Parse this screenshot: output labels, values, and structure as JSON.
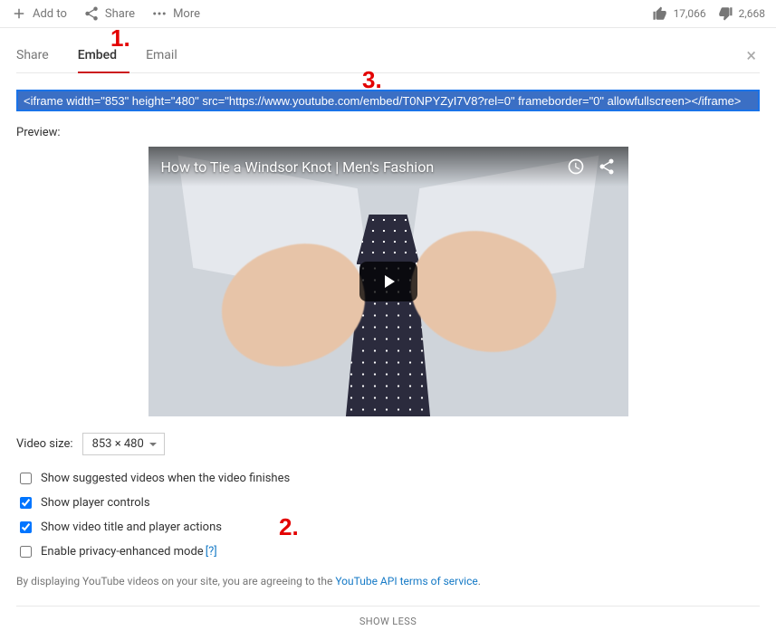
{
  "toolbar": {
    "add_to": "Add to",
    "share": "Share",
    "more": "More",
    "likes": "17,066",
    "dislikes": "2,668"
  },
  "tabs": {
    "share": "Share",
    "embed": "Embed",
    "email": "Email"
  },
  "embed_code": "<iframe width=\"853\" height=\"480\" src=\"https://www.youtube.com/embed/T0NPYZyI7V8?rel=0\" frameborder=\"0\" allowfullscreen></iframe>",
  "preview_label": "Preview:",
  "video": {
    "title": "How to Tie a Windsor Knot | Men's Fashion"
  },
  "options": {
    "video_size_label": "Video size:",
    "video_size_value": "853 × 480",
    "opt_suggested": "Show suggested videos when the video finishes",
    "opt_controls": "Show player controls",
    "opt_title_actions": "Show video title and player actions",
    "opt_privacy": "Enable privacy-enhanced mode",
    "opt_privacy_help": "[?]"
  },
  "disclaimer_prefix": "By displaying YouTube videos on your site, you are agreeing to the ",
  "disclaimer_link": "YouTube API terms of service",
  "disclaimer_suffix": ".",
  "show_less": "SHOW LESS",
  "annotations": {
    "a1": "1.",
    "a2": "2.",
    "a3": "3."
  }
}
